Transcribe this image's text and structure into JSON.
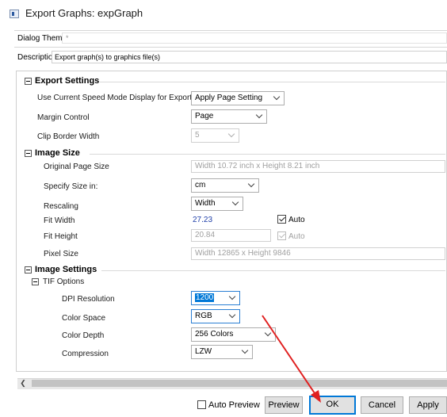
{
  "window": {
    "title": "Export Graphs: expGraph"
  },
  "dialog_theme": {
    "label": "Dialog Theme",
    "value": "*"
  },
  "description": {
    "label": "Description",
    "value": "Export graph(s) to graphics file(s)"
  },
  "groups": {
    "export_settings": {
      "title": "Export Settings",
      "rows": {
        "speed_mode": {
          "label": "Use Current Speed Mode Display for Export",
          "value": "Apply Page Setting"
        },
        "margin_control": {
          "label": "Margin Control",
          "value": "Page"
        },
        "clip_border": {
          "label": "Clip Border Width",
          "value": "5"
        }
      }
    },
    "image_size": {
      "title": "Image Size",
      "rows": {
        "original_page_size": {
          "label": "Original Page Size",
          "value": "Width 10.72 inch x Height 8.21 inch"
        },
        "specify_size_in": {
          "label": "Specify Size in:",
          "value": "cm"
        },
        "rescaling": {
          "label": "Rescaling",
          "value": "Width"
        },
        "fit_width": {
          "label": "Fit Width",
          "value": "27.23",
          "auto_label": "Auto",
          "auto_checked": true
        },
        "fit_height": {
          "label": "Fit Height",
          "value": "20.84",
          "auto_label": "Auto",
          "auto_checked": true
        },
        "pixel_size": {
          "label": "Pixel Size",
          "value": "Width 12865 x Height 9846"
        }
      }
    },
    "image_settings": {
      "title": "Image Settings",
      "tif_options": {
        "title": "TIF Options",
        "rows": {
          "dpi": {
            "label": "DPI Resolution",
            "value": "1200"
          },
          "color_space": {
            "label": "Color Space",
            "value": "RGB"
          },
          "color_depth": {
            "label": "Color Depth",
            "value": "256 Colors"
          },
          "compression": {
            "label": "Compression",
            "value": "LZW"
          }
        }
      }
    }
  },
  "footer": {
    "auto_preview_label": "Auto Preview",
    "auto_preview_checked": false,
    "preview_label": "Preview",
    "ok_label": "OK",
    "cancel_label": "Cancel",
    "apply_label": "Apply"
  },
  "colors": {
    "accent": "#0078d7",
    "value_blue": "#1f3fa8",
    "annotation_arrow": "#e02020"
  }
}
